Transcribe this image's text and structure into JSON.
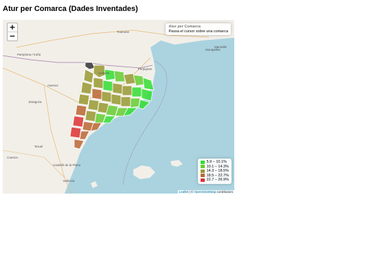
{
  "page": {
    "title": "Atur per Comarca (Dades Inventades)"
  },
  "map": {
    "zoom_in_label": "+",
    "zoom_out_label": "−",
    "info_title": "Atur per Comarca",
    "info_text": "Passa el cursor sobre una comarca",
    "place_labels": [
      "Toulouse",
      "Montpellier",
      "Marseille",
      "Perpignan",
      "Andorra",
      "Pamplona / Iruña",
      "Huesca",
      "Zaragoza",
      "Teruel",
      "Castelló de la Plana",
      "València",
      "Cuenca"
    ],
    "legend": [
      {
        "range": "5.9 – 10.1%",
        "color": "#33dd33"
      },
      {
        "range": "10.1 – 14.3%",
        "color": "#66cc33"
      },
      {
        "range": "14.3 – 18.5%",
        "color": "#999933"
      },
      {
        "range": "18.5 – 22.7%",
        "color": "#bb6633"
      },
      {
        "range": "22.7 – 26.9%",
        "color": "#dd3333"
      }
    ],
    "attribution": {
      "leaflet": "Leaflet",
      "separator": " | © ",
      "osm": "OpenStreetMap",
      "suffix": " contributors"
    },
    "colors": {
      "sea": "#aad3df",
      "land": "#f2efe9",
      "border": "#9e7aa8",
      "no_data": "#333333"
    }
  }
}
